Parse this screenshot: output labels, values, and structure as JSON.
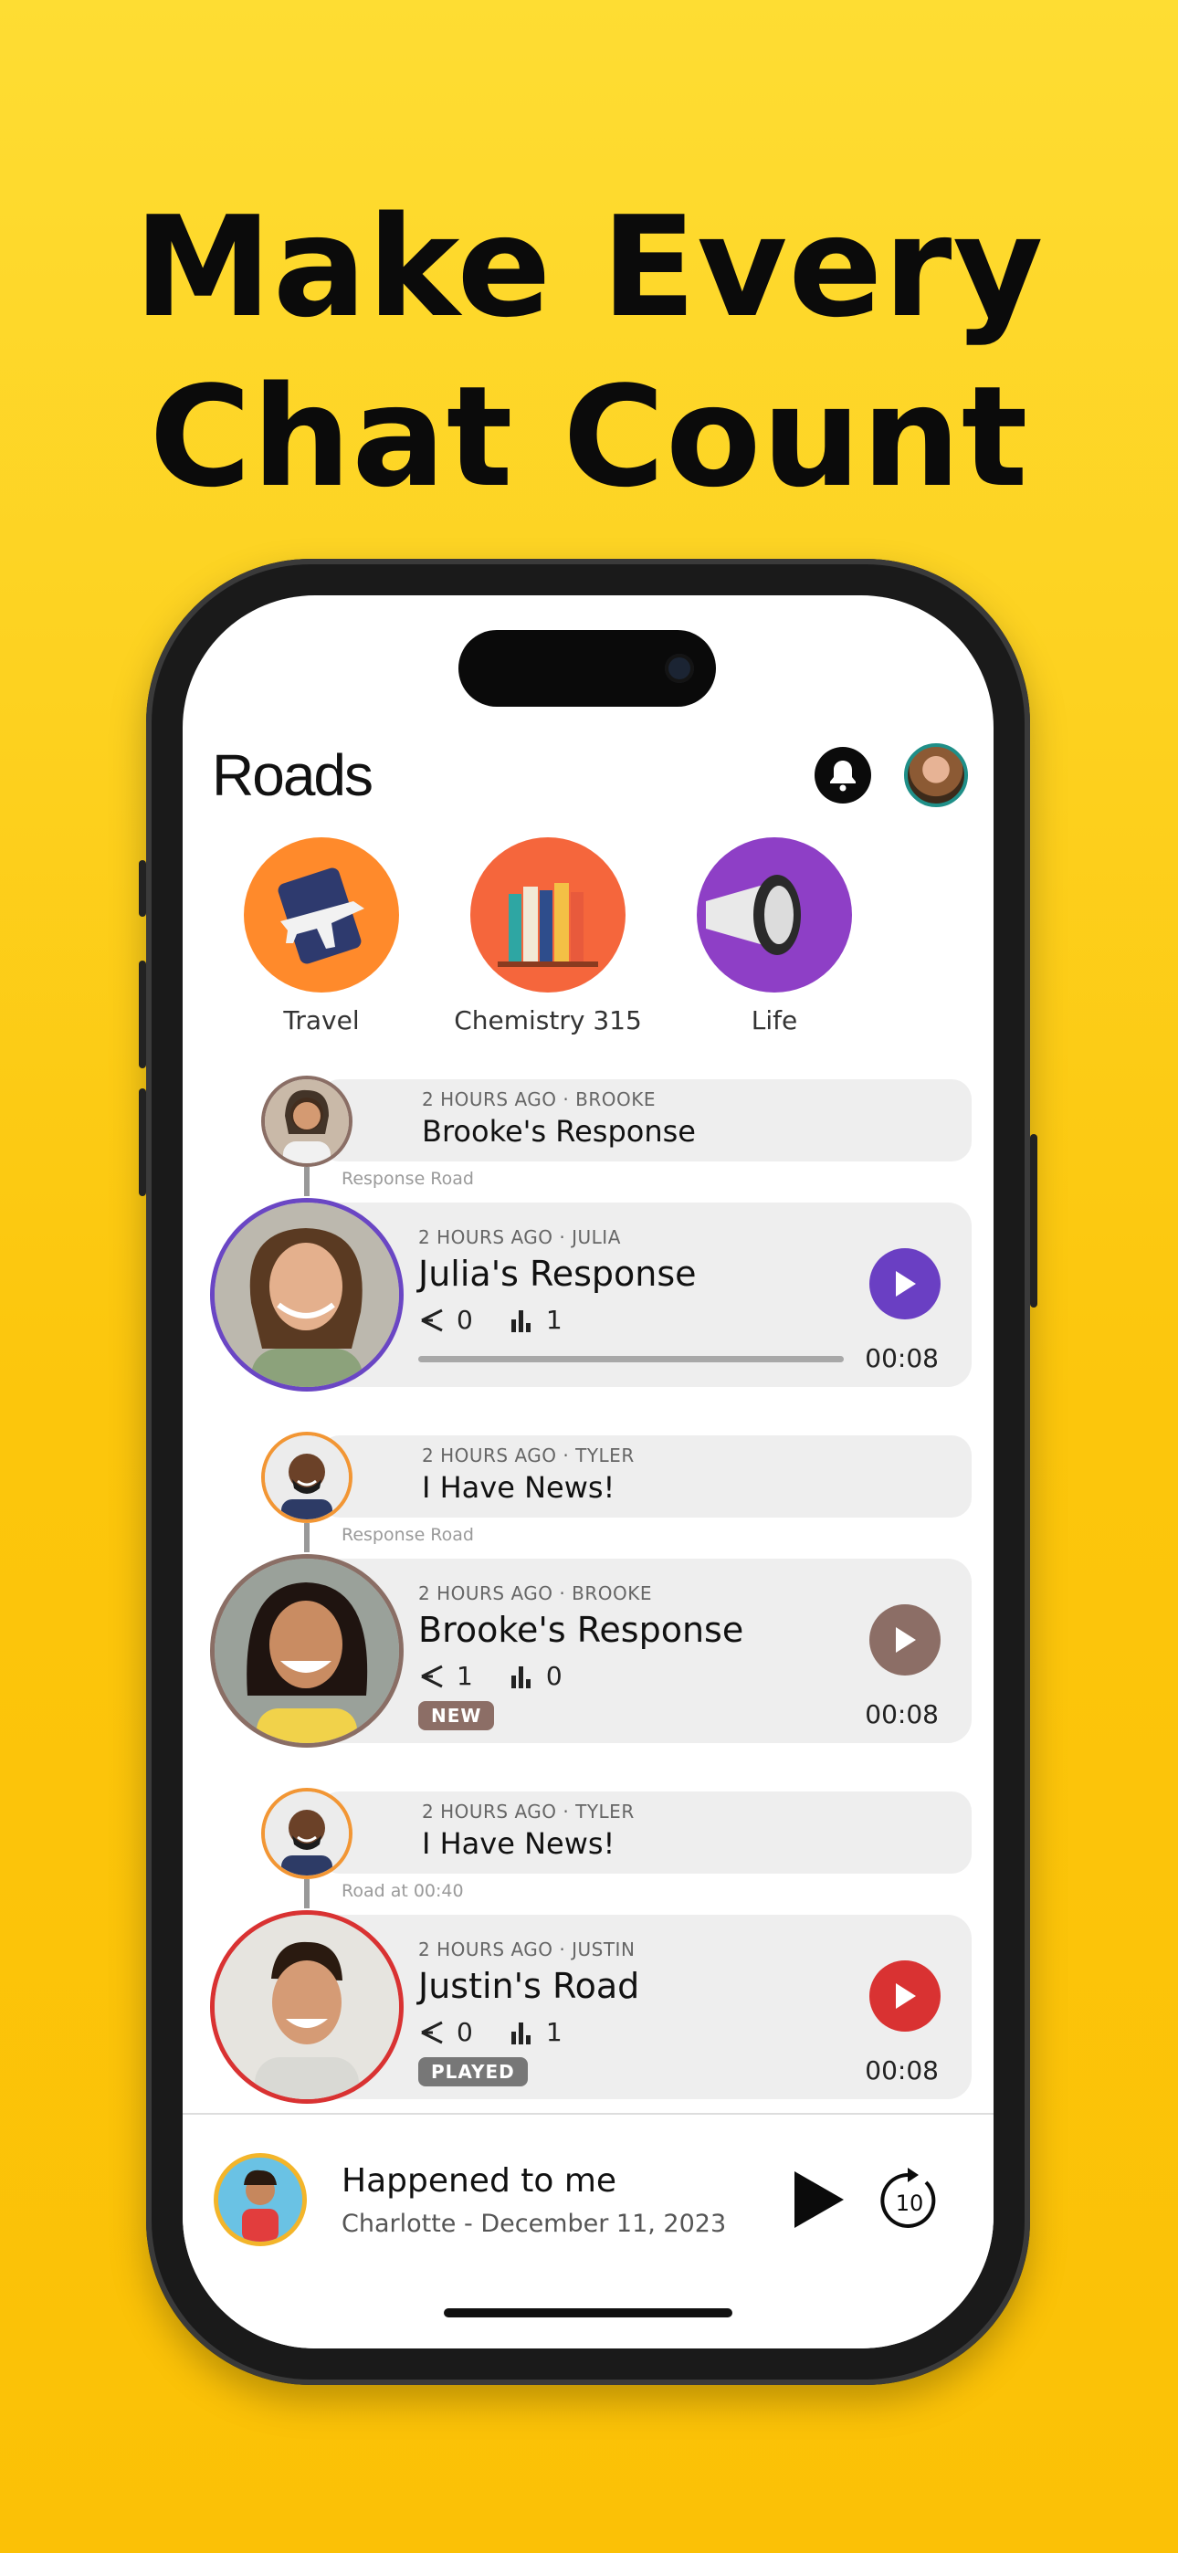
{
  "headline": {
    "line1": "Make Every",
    "line2": "Chat Count"
  },
  "app": {
    "logo": "Roads"
  },
  "categories": [
    {
      "label": "Travel"
    },
    {
      "label": "Chemistry 315"
    },
    {
      "label": "Life"
    }
  ],
  "threads": [
    {
      "parent": {
        "time": "2 HOURS AGO",
        "author": "BROOKE",
        "title": "Brooke's Response"
      },
      "road_label": "Response Road",
      "card": {
        "time": "2 HOURS AGO",
        "author": "JULIA",
        "title": "Julia's Response",
        "shares": "0",
        "listens": "1",
        "duration": "00:08",
        "play_color": "#6A3FC3",
        "badge": ""
      }
    },
    {
      "parent": {
        "time": "2 HOURS AGO",
        "author": "TYLER",
        "title": "I Have News!"
      },
      "road_label": "Response Road",
      "card": {
        "time": "2 HOURS AGO",
        "author": "BROOKE",
        "title": "Brooke's Response",
        "shares": "1",
        "listens": "0",
        "duration": "00:08",
        "play_color": "#8C6E66",
        "badge": "NEW",
        "badge_color": "#8C6E66"
      }
    },
    {
      "parent": {
        "time": "2 HOURS AGO",
        "author": "TYLER",
        "title": "I Have News!"
      },
      "road_label": "Road at 00:40",
      "card": {
        "time": "2 HOURS AGO",
        "author": "JUSTIN",
        "title": "Justin's Road",
        "shares": "0",
        "listens": "1",
        "duration": "00:08",
        "play_color": "#D93232",
        "badge": "PLAYED",
        "badge_color": "#777777"
      }
    }
  ],
  "meta_separator": "·",
  "player": {
    "title": "Happened to me",
    "subtitle": "Charlotte - December 11, 2023",
    "skip_seconds": "10"
  },
  "colors": {
    "background": "#FCC60C",
    "text": "#0B0B0B"
  }
}
